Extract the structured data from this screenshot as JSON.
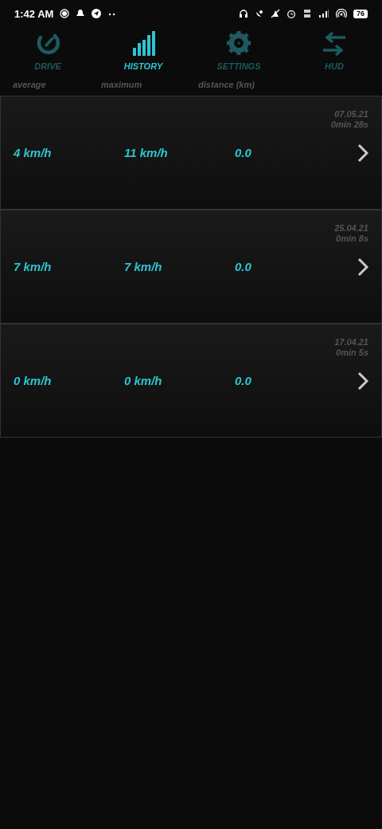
{
  "status_bar": {
    "time": "1:42 AM",
    "battery": "76"
  },
  "tabs": [
    {
      "label": "DRIVE",
      "kind": "gauge",
      "selected": false
    },
    {
      "label": "HISTORY",
      "kind": "bars",
      "selected": true
    },
    {
      "label": "SETTINGS",
      "kind": "gear",
      "selected": false
    },
    {
      "label": "HUD",
      "kind": "arrows",
      "selected": false
    }
  ],
  "columns": [
    "average",
    "maximum",
    "distance (km)"
  ],
  "trips": [
    {
      "average": "4 km/h",
      "maximum": "11 km/h",
      "distance": "0.0",
      "date": "07.05.21",
      "duration": "0min 28s"
    },
    {
      "average": "7 km/h",
      "maximum": "7 km/h",
      "distance": "0.0",
      "date": "25.04.21",
      "duration": "0min 8s"
    },
    {
      "average": "0 km/h",
      "maximum": "0 km/h",
      "distance": "0.0",
      "date": "17.04.21",
      "duration": "0min 5s"
    }
  ]
}
